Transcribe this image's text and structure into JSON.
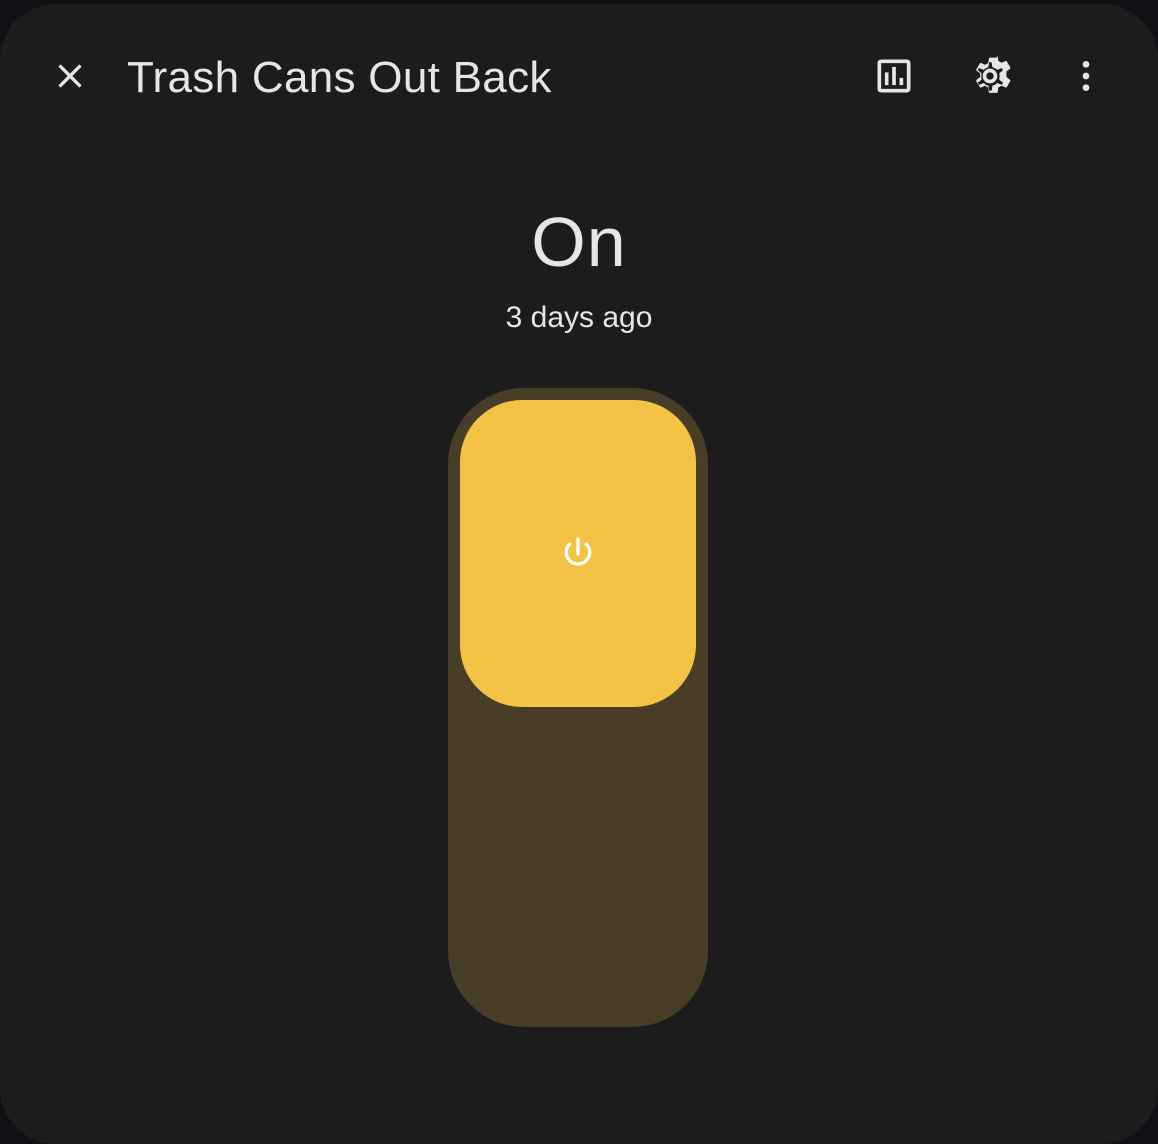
{
  "dialog": {
    "title": "Trash Cans Out Back",
    "close_icon": "close-icon",
    "history_icon": "chart-box-icon",
    "settings_icon": "gear-icon",
    "menu_icon": "dots-vertical-icon"
  },
  "entity": {
    "state": "On",
    "last_changed": "3 days ago",
    "is_on": true,
    "toggle_icon": "power-icon"
  },
  "colors": {
    "background": "#1c1c1c",
    "text": "#e6e6e6",
    "accent": "#f4c244",
    "track": "#483d27"
  }
}
